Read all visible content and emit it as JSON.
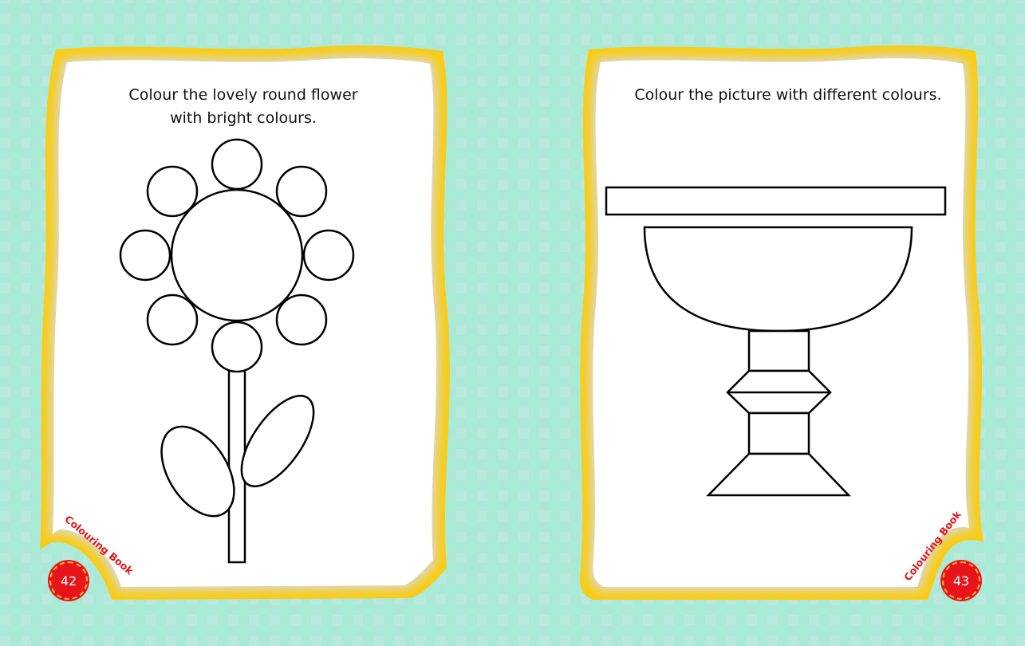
{
  "left_page": {
    "instruction": "Colour the lovely round flower\nwith bright colours.",
    "brand": "Colouring Book",
    "page_number": "42",
    "drawing": "flower-outline"
  },
  "right_page": {
    "instruction": "Colour the picture with different colours.",
    "brand": "Colouring Book",
    "page_number": "43",
    "drawing": "vase-outline"
  },
  "colors": {
    "background": "#a9ecd6",
    "frame_border": "#f8cc16",
    "badge": "#e8141b",
    "brand_text": "#e3141b"
  }
}
